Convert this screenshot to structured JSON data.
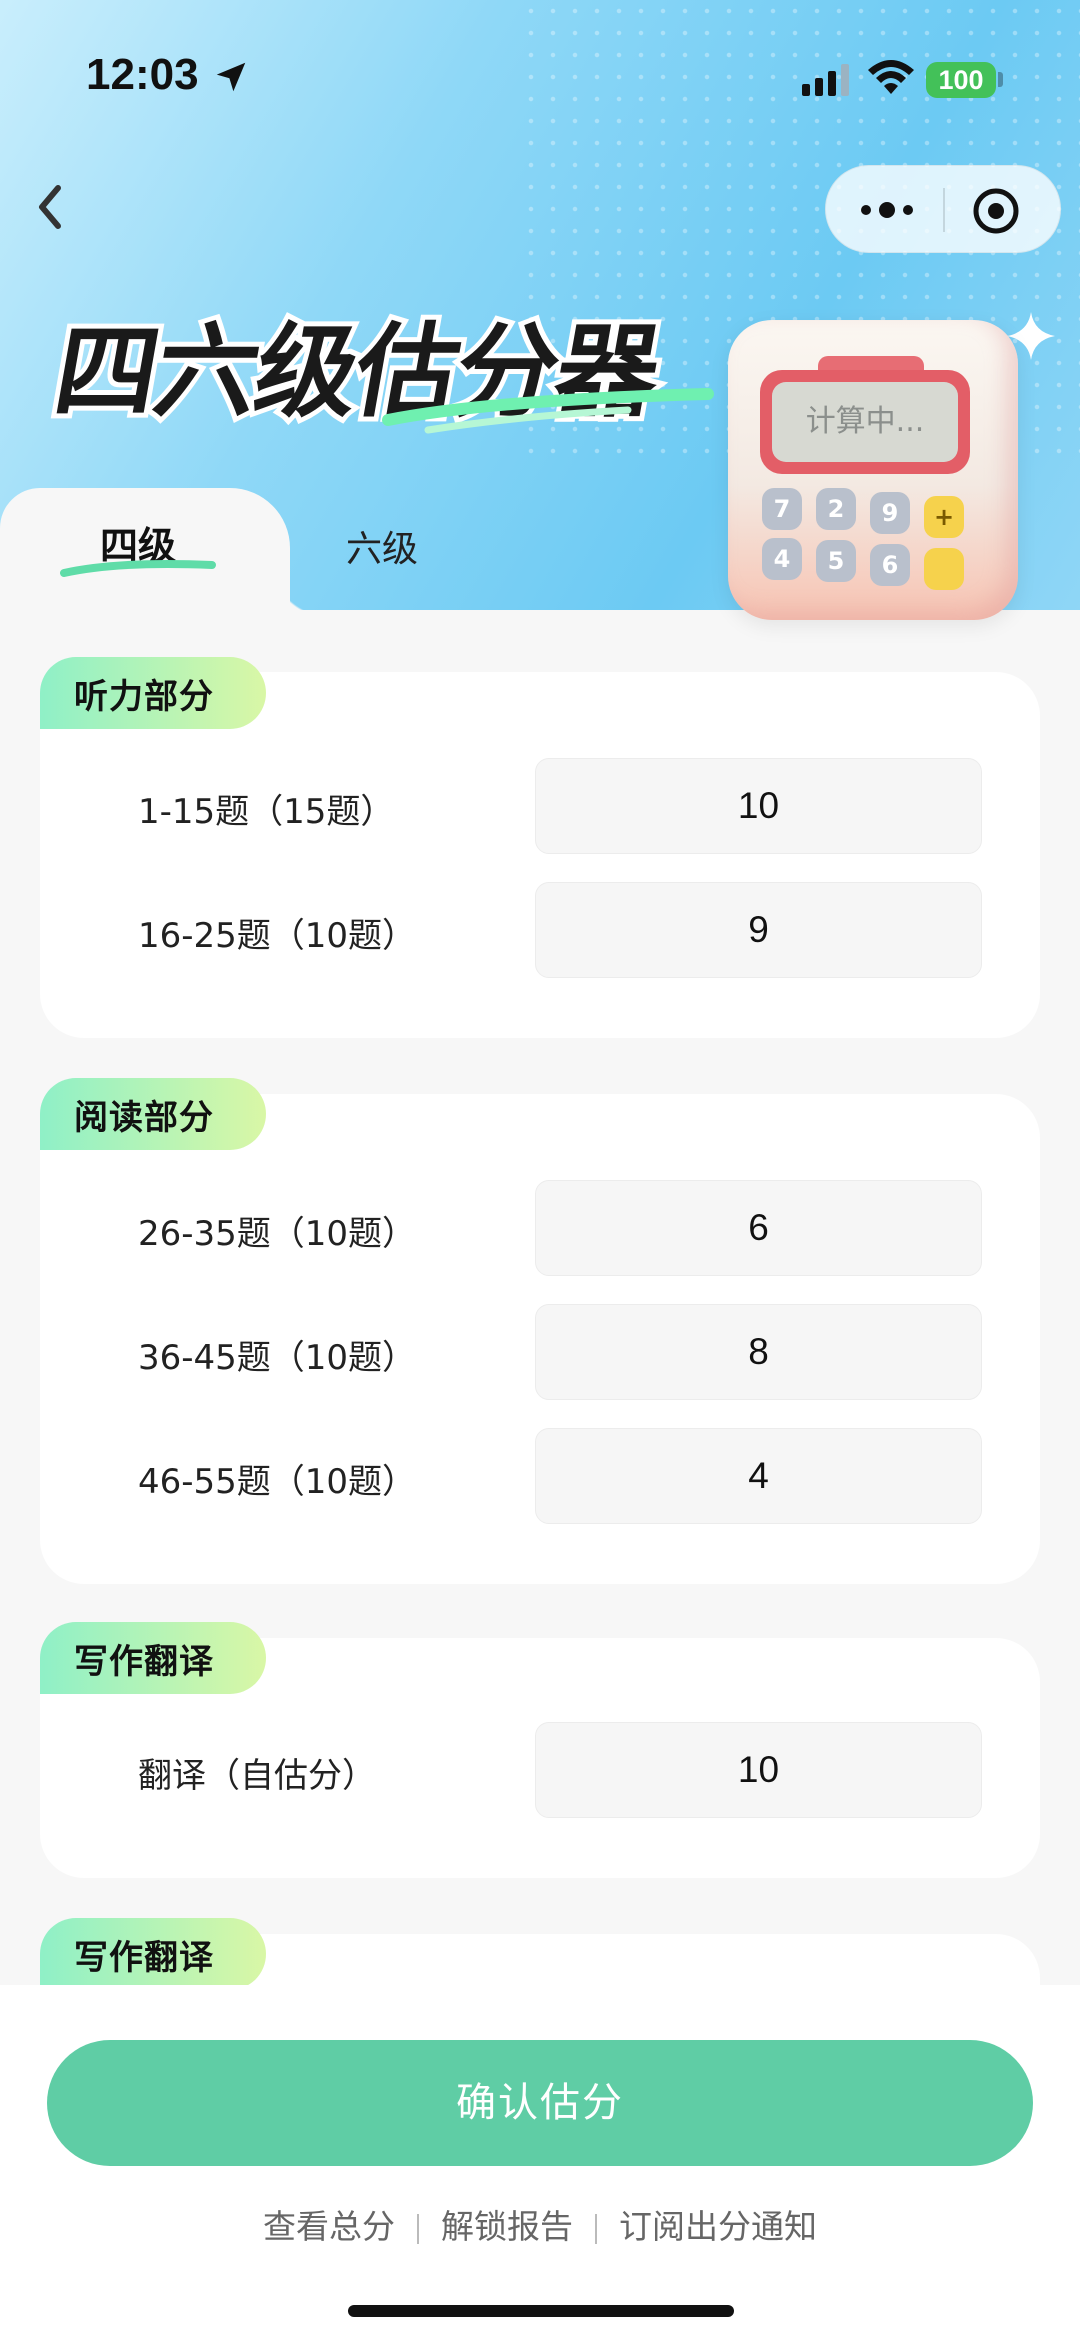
{
  "status_bar": {
    "time": "12:03",
    "battery": "100"
  },
  "header": {
    "title": "四六级估分器",
    "calculator_screen": "计算中...",
    "calculator_keys": [
      "7",
      "2",
      "9",
      "+",
      "4",
      "5",
      "6"
    ]
  },
  "tabs": [
    {
      "label": "四级",
      "active": true
    },
    {
      "label": "六级",
      "active": false
    }
  ],
  "sections": [
    {
      "title": "听力部分",
      "rows": [
        {
          "label": "1-15题（15题）",
          "value": "10"
        },
        {
          "label": "16-25题（10题）",
          "value": "9"
        }
      ]
    },
    {
      "title": "阅读部分",
      "rows": [
        {
          "label": "26-35题（10题）",
          "value": "6"
        },
        {
          "label": "36-45题（10题）",
          "value": "8"
        },
        {
          "label": "46-55题（10题）",
          "value": "4"
        }
      ]
    },
    {
      "title": "写作翻译",
      "rows": [
        {
          "label": "翻译（自估分）",
          "value": "10"
        }
      ]
    },
    {
      "title": "写作翻译",
      "rows": []
    }
  ],
  "actions": {
    "confirm_label": "确认估分",
    "links": [
      "查看总分",
      "解锁报告",
      "订阅出分通知"
    ]
  },
  "colors": {
    "accent": "#5fcda5",
    "tag_gradient_start": "#8ff0c7",
    "tag_gradient_end": "#d9f7a6",
    "battery": "#43c159"
  }
}
